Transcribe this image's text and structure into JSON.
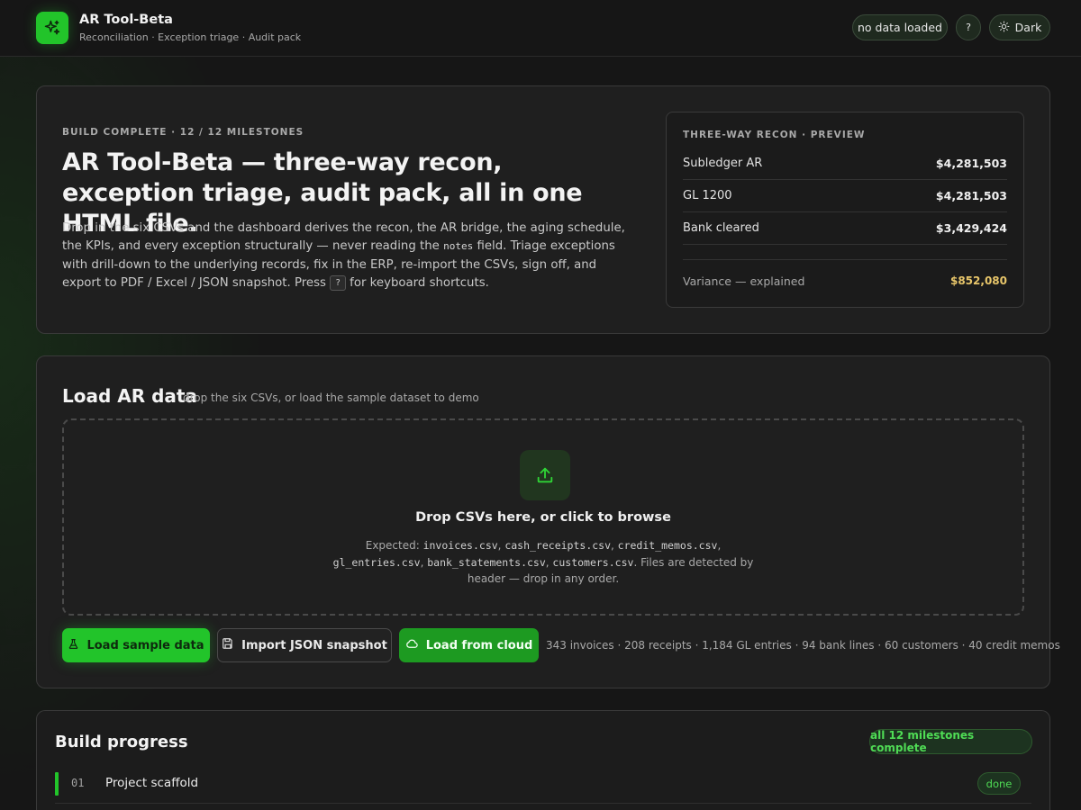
{
  "header": {
    "app_title": "AR Tool-Beta",
    "app_subtitle": "Reconciliation · Exception triage · Audit pack",
    "status_pill": "no data loaded",
    "help_label": "?",
    "theme_label": "Dark",
    "accent_color": "#22c42a"
  },
  "hero": {
    "eyebrow": "BUILD COMPLETE · 12 / 12 MILESTONES",
    "title": "AR Tool-Beta — three-way recon, exception triage, audit pack, all in one HTML file.",
    "desc_1": "Drop in the six CSVs and the dashboard derives the recon, the AR bridge, the aging schedule, the KPIs, and every exception structurally — never reading the ",
    "desc_code": "notes",
    "desc_2": " field. Triage exceptions with drill-down to the underlying records, fix in the ERP, re-import the CSVs, sign off, and export to PDF / Excel / JSON snapshot. Press ",
    "desc_kbd": "?",
    "desc_3": " for keyboard shortcuts."
  },
  "recon_preview": {
    "title": "THREE-WAY RECON · PREVIEW",
    "rows": [
      {
        "label": "Subledger AR",
        "value": "$4,281,503"
      },
      {
        "label": "GL 1200",
        "value": "$4,281,503"
      },
      {
        "label": "Bank cleared",
        "value": "$3,429,424"
      }
    ],
    "variance_label": "Variance — explained",
    "variance_value": "$852,080"
  },
  "load": {
    "title": "Load AR data",
    "subtitle": "drop the six CSVs, or load the sample dataset to demo",
    "drop_title": "Drop CSVs here, or click to browse",
    "expected_prefix": "Expected: ",
    "files": [
      "invoices.csv",
      "cash_receipts.csv",
      "credit_memos.csv",
      "gl_entries.csv",
      "bank_statements.csv",
      "customers.csv"
    ],
    "expected_suffix": ". Files are detected by header — drop in any order.",
    "btn_sample": "Load sample data",
    "btn_json": "Import JSON snapshot",
    "btn_cloud": "Load from cloud",
    "counts": "343 invoices · 208 receipts · 1,184 GL entries · 94 bank lines · 60 customers · 40 credit memos"
  },
  "build": {
    "title": "Build progress",
    "badge": "all 12 milestones complete",
    "milestones": [
      {
        "num": "01",
        "label": "Project scaffold",
        "status": "done"
      }
    ]
  }
}
